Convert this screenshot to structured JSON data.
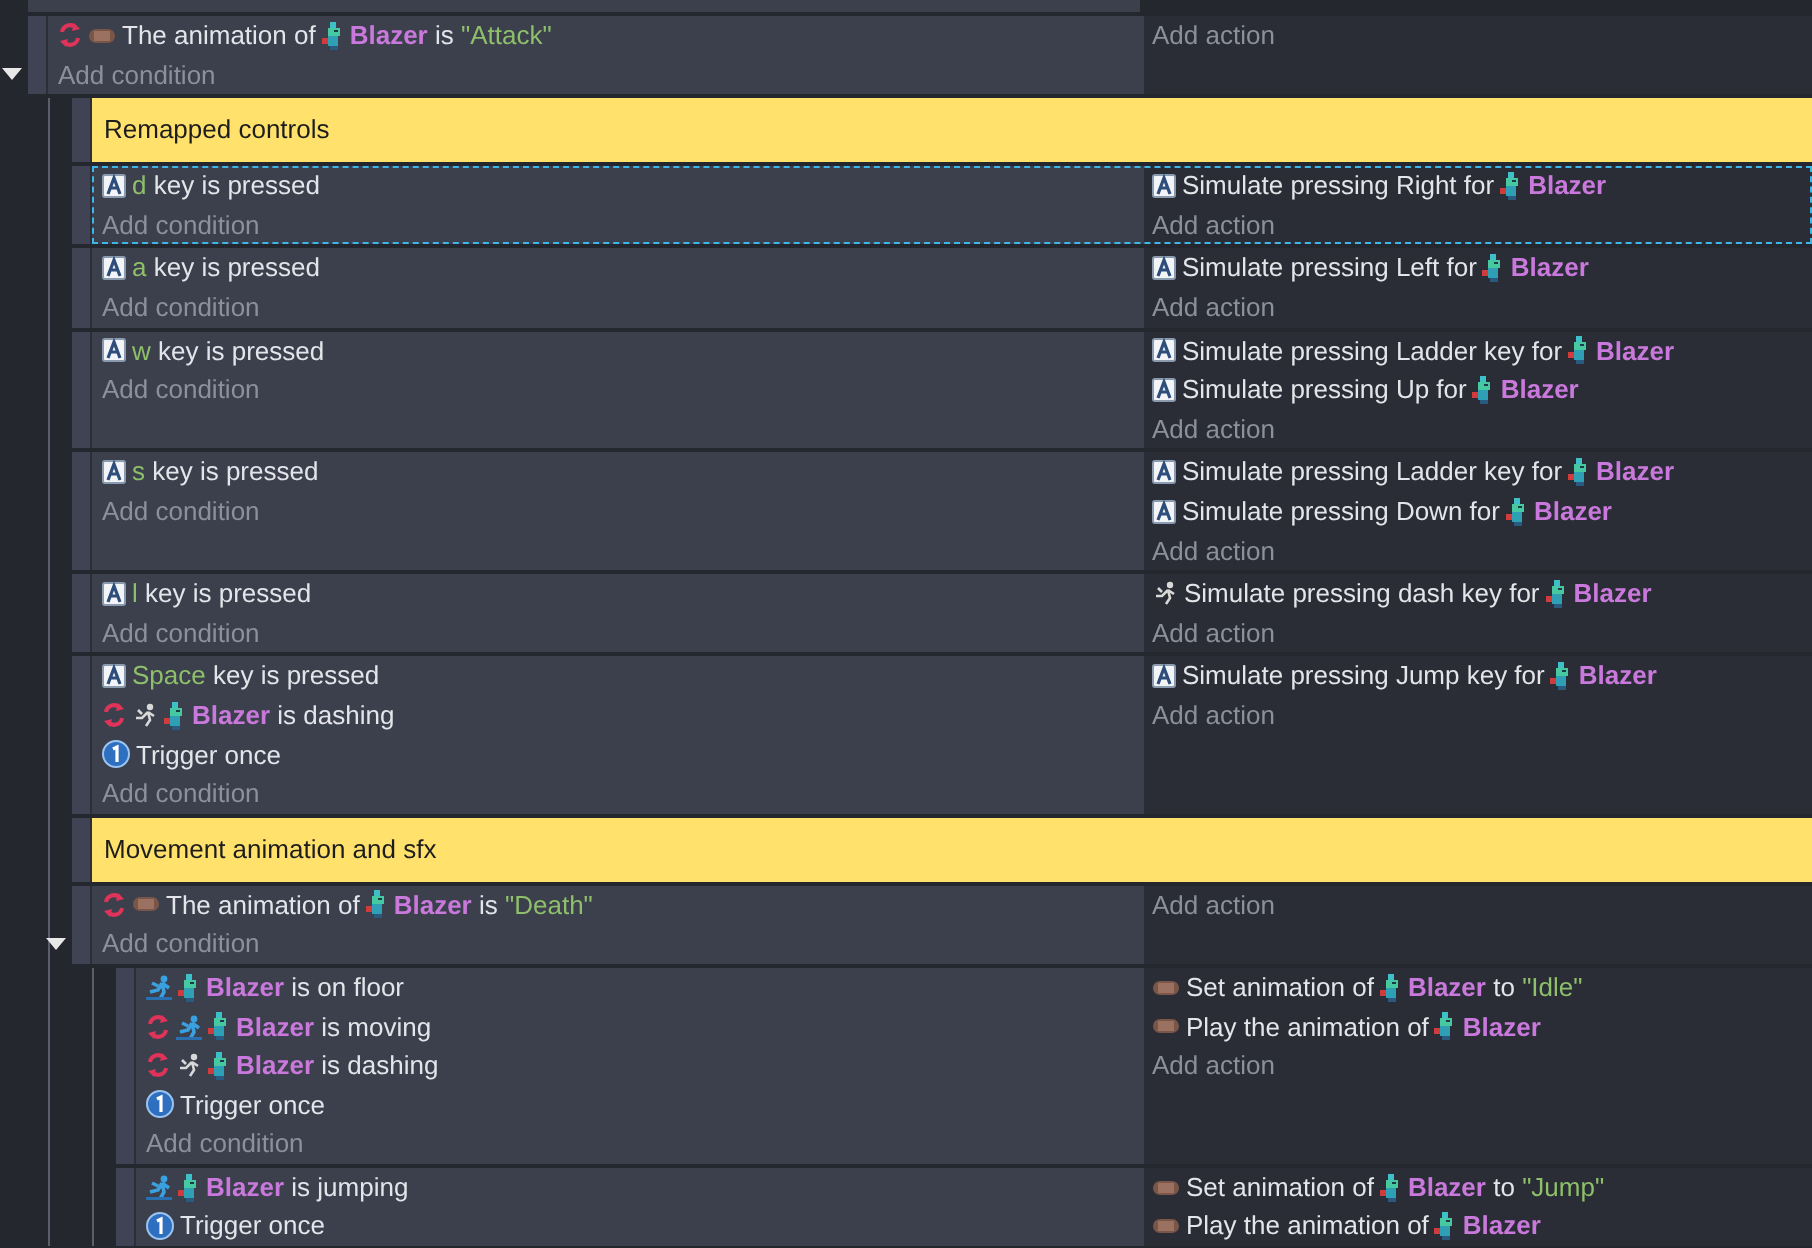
{
  "events": [
    {
      "kind": "event",
      "selected": false,
      "expanded": true,
      "conditions": [
        {
          "kind": "animation",
          "inverted": true,
          "parts": [
            {
              "kind": "text",
              "text": "The animation of"
            },
            {
              "kind": "object"
            },
            {
              "kind": "text",
              "text": "**Blazer** is *\"Attack\"*"
            }
          ]
        }
      ],
      "add_condition": "Add condition",
      "add_action": "Add action",
      "children": [
        {
          "kind": "comment",
          "text": "Remapped controls"
        },
        {
          "kind": "event",
          "selected": true,
          "conditions": [
            {
              "kind": "keyboard",
              "inverted": false,
              "parts": [
                {
                  "kind": "text",
                  "text": "*d* key is pressed"
                }
              ]
            }
          ],
          "add_condition": "Add condition",
          "actions": [
            {
              "kind": "keyboard",
              "parts": [
                {
                  "kind": "text",
                  "text": "Simulate pressing Right for"
                },
                {
                  "kind": "object"
                },
                {
                  "kind": "text",
                  "text": "**Blazer**"
                }
              ]
            }
          ],
          "add_action": "Add action"
        },
        {
          "kind": "event",
          "selected": false,
          "conditions": [
            {
              "kind": "keyboard",
              "inverted": false,
              "parts": [
                {
                  "kind": "text",
                  "text": "*a* key is pressed"
                }
              ]
            }
          ],
          "add_condition": "Add condition",
          "actions": [
            {
              "kind": "keyboard",
              "parts": [
                {
                  "kind": "text",
                  "text": "Simulate pressing Left for"
                },
                {
                  "kind": "object"
                },
                {
                  "kind": "text",
                  "text": "**Blazer**"
                }
              ]
            }
          ],
          "add_action": "Add action"
        },
        {
          "kind": "event",
          "selected": false,
          "conditions": [
            {
              "kind": "keyboard",
              "inverted": false,
              "parts": [
                {
                  "kind": "text",
                  "text": "*w* key is pressed"
                }
              ]
            }
          ],
          "add_condition": "Add condition",
          "actions": [
            {
              "kind": "keyboard",
              "parts": [
                {
                  "kind": "text",
                  "text": "Simulate pressing Ladder key for"
                },
                {
                  "kind": "object"
                },
                {
                  "kind": "text",
                  "text": "**Blazer**"
                }
              ]
            },
            {
              "kind": "keyboard",
              "parts": [
                {
                  "kind": "text",
                  "text": "Simulate pressing Up for"
                },
                {
                  "kind": "object"
                },
                {
                  "kind": "text",
                  "text": "**Blazer**"
                }
              ]
            }
          ],
          "add_action": "Add action"
        },
        {
          "kind": "event",
          "selected": false,
          "conditions": [
            {
              "kind": "keyboard",
              "inverted": false,
              "parts": [
                {
                  "kind": "text",
                  "text": "*s* key is pressed"
                }
              ]
            }
          ],
          "add_condition": "Add condition",
          "actions": [
            {
              "kind": "keyboard",
              "parts": [
                {
                  "kind": "text",
                  "text": "Simulate pressing Ladder key for"
                },
                {
                  "kind": "object"
                },
                {
                  "kind": "text",
                  "text": "**Blazer**"
                }
              ]
            },
            {
              "kind": "keyboard",
              "parts": [
                {
                  "kind": "text",
                  "text": "Simulate pressing Down for"
                },
                {
                  "kind": "object"
                },
                {
                  "kind": "text",
                  "text": "**Blazer**"
                }
              ]
            }
          ],
          "add_action": "Add action"
        },
        {
          "kind": "event",
          "selected": false,
          "conditions": [
            {
              "kind": "keyboard",
              "inverted": false,
              "parts": [
                {
                  "kind": "text",
                  "text": "*l* key is pressed"
                }
              ]
            }
          ],
          "add_condition": "Add condition",
          "actions": [
            {
              "kind": "dash",
              "parts": [
                {
                  "kind": "text",
                  "text": "Simulate pressing dash key for"
                },
                {
                  "kind": "object"
                },
                {
                  "kind": "text",
                  "text": "**Blazer**"
                }
              ]
            }
          ],
          "add_action": "Add action"
        },
        {
          "kind": "event",
          "selected": false,
          "conditions": [
            {
              "kind": "keyboard",
              "inverted": false,
              "parts": [
                {
                  "kind": "text",
                  "text": "*Space* key is pressed"
                }
              ]
            },
            {
              "kind": "dash",
              "inverted": true,
              "parts": [
                {
                  "kind": "object"
                },
                {
                  "kind": "text",
                  "text": "**Blazer** is dashing"
                }
              ]
            },
            {
              "kind": "once",
              "inverted": false,
              "parts": [
                {
                  "kind": "text",
                  "text": "Trigger once"
                }
              ]
            }
          ],
          "add_condition": "Add condition",
          "actions": [
            {
              "kind": "keyboard",
              "parts": [
                {
                  "kind": "text",
                  "text": "Simulate pressing Jump key for"
                },
                {
                  "kind": "object"
                },
                {
                  "kind": "text",
                  "text": "**Blazer**"
                }
              ]
            }
          ],
          "add_action": "Add action"
        },
        {
          "kind": "comment",
          "text": "Movement animation and sfx"
        },
        {
          "kind": "event",
          "selected": false,
          "expanded": true,
          "conditions": [
            {
              "kind": "animation",
              "inverted": true,
              "parts": [
                {
                  "kind": "text",
                  "text": "The animation of"
                },
                {
                  "kind": "object"
                },
                {
                  "kind": "text",
                  "text": "**Blazer** is *\"Death\"*"
                }
              ]
            }
          ],
          "add_condition": "Add condition",
          "add_action": "Add action",
          "children": [
            {
              "kind": "event",
              "selected": false,
              "conditions": [
                {
                  "kind": "platformer",
                  "inverted": false,
                  "parts": [
                    {
                      "kind": "object"
                    },
                    {
                      "kind": "text",
                      "text": "**Blazer** is on floor"
                    }
                  ]
                },
                {
                  "kind": "platformer",
                  "inverted": true,
                  "parts": [
                    {
                      "kind": "object"
                    },
                    {
                      "kind": "text",
                      "text": "**Blazer** is moving"
                    }
                  ]
                },
                {
                  "kind": "dash",
                  "inverted": true,
                  "parts": [
                    {
                      "kind": "object"
                    },
                    {
                      "kind": "text",
                      "text": "**Blazer** is dashing"
                    }
                  ]
                },
                {
                  "kind": "once",
                  "inverted": false,
                  "parts": [
                    {
                      "kind": "text",
                      "text": "Trigger once"
                    }
                  ]
                }
              ],
              "add_condition": "Add condition",
              "actions": [
                {
                  "kind": "animation",
                  "parts": [
                    {
                      "kind": "text",
                      "text": "Set animation of"
                    },
                    {
                      "kind": "object"
                    },
                    {
                      "kind": "text",
                      "text": "**Blazer** to *\"Idle\"*"
                    }
                  ]
                },
                {
                  "kind": "animation",
                  "parts": [
                    {
                      "kind": "text",
                      "text": "Play the animation of"
                    },
                    {
                      "kind": "object"
                    },
                    {
                      "kind": "text",
                      "text": "**Blazer**"
                    }
                  ]
                }
              ],
              "add_action": "Add action"
            },
            {
              "kind": "event",
              "selected": false,
              "conditions": [
                {
                  "kind": "platformer",
                  "inverted": false,
                  "parts": [
                    {
                      "kind": "object"
                    },
                    {
                      "kind": "text",
                      "text": "**Blazer** is jumping"
                    }
                  ]
                },
                {
                  "kind": "once",
                  "inverted": false,
                  "parts": [
                    {
                      "kind": "text",
                      "text": "Trigger once"
                    }
                  ]
                }
              ],
              "actions": [
                {
                  "kind": "animation",
                  "parts": [
                    {
                      "kind": "text",
                      "text": "Set animation of"
                    },
                    {
                      "kind": "object"
                    },
                    {
                      "kind": "text",
                      "text": "**Blazer** to *\"Jump\"*"
                    }
                  ]
                },
                {
                  "kind": "animation",
                  "parts": [
                    {
                      "kind": "text",
                      "text": "Play the animation of"
                    },
                    {
                      "kind": "object"
                    },
                    {
                      "kind": "text",
                      "text": "**Blazer**"
                    }
                  ]
                }
              ]
            }
          ]
        }
      ]
    }
  ]
}
